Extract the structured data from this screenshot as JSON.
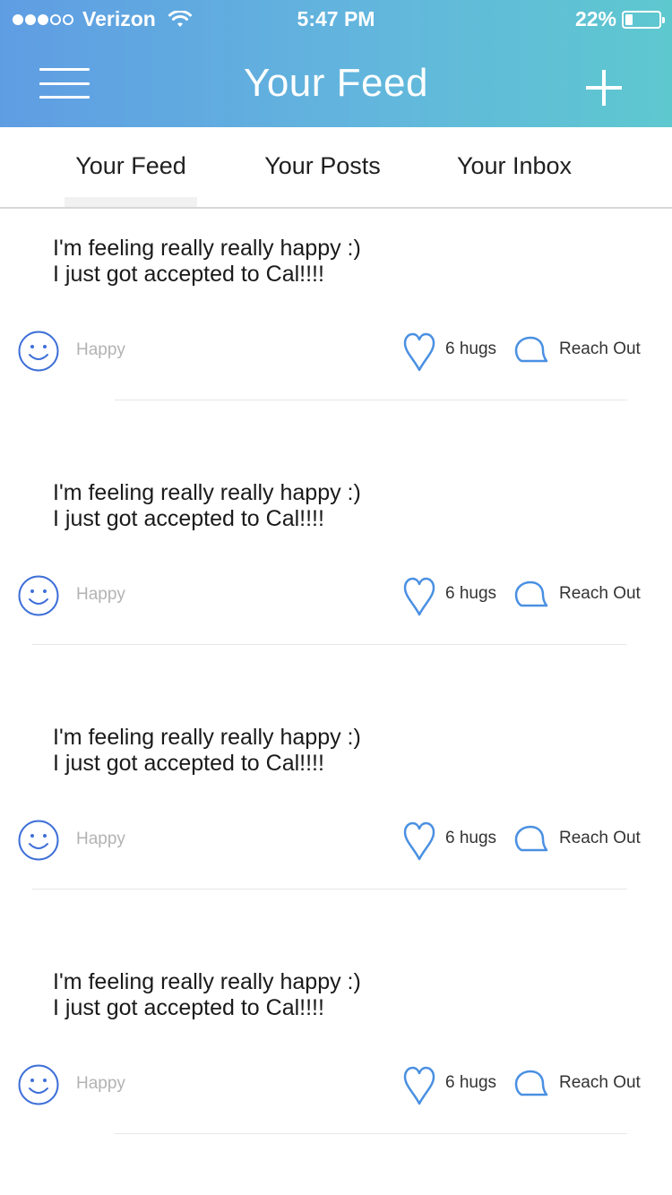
{
  "status_bar": {
    "carrier": "Verizon",
    "signal_bars_filled": 3,
    "signal_bars_total": 5,
    "time": "5:47 PM",
    "battery_percent": "22%",
    "battery_level": 0.22
  },
  "nav": {
    "title": "Your Feed",
    "menu_icon": "hamburger-icon",
    "add_icon": "plus-icon"
  },
  "tabs": [
    {
      "label": "Your Feed",
      "selected": true
    },
    {
      "label": "Your Posts",
      "selected": false
    },
    {
      "label": "Your Inbox",
      "selected": false
    }
  ],
  "posts": [
    {
      "text": "I'm feeling really really happy :)\nI just got accepted to Cal!!!!",
      "mood": "Happy",
      "hugs": "6 hugs",
      "reach_out": "Reach Out"
    },
    {
      "text": "I'm feeling really really happy :)\nI just got accepted to Cal!!!!",
      "mood": "Happy",
      "hugs": "6 hugs",
      "reach_out": "Reach Out"
    },
    {
      "text": "I'm feeling really really happy :)\nI just got accepted to Cal!!!!",
      "mood": "Happy",
      "hugs": "6 hugs",
      "reach_out": "Reach Out"
    },
    {
      "text": "I'm feeling really really happy :)\nI just got accepted to Cal!!!!",
      "mood": "Happy",
      "hugs": "6 hugs",
      "reach_out": "Reach Out"
    }
  ],
  "colors": {
    "header_gradient_start": "#5f9de3",
    "header_gradient_end": "#5ec8cf",
    "icon_blue": "#4a90e2",
    "mood_label": "#b3b3b3"
  }
}
